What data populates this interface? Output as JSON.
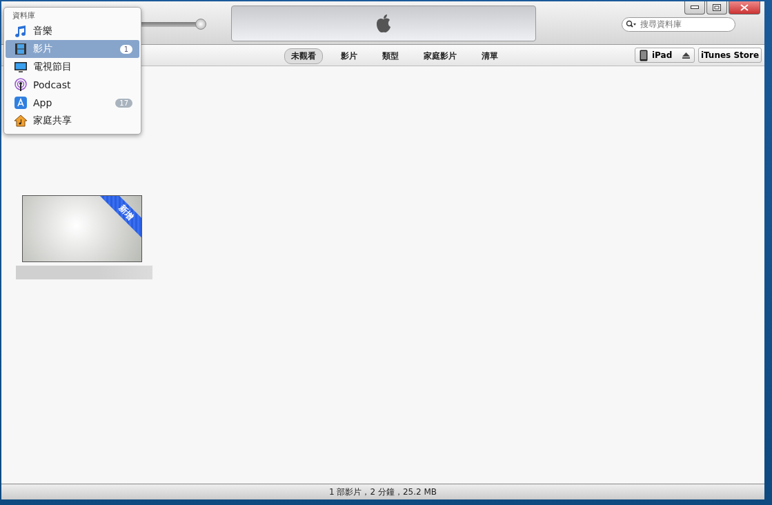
{
  "toolbar": {
    "volume": {
      "level": 0.96
    },
    "search": {
      "placeholder": "搜尋資料庫"
    }
  },
  "library_menu": {
    "title": "資料庫",
    "items": [
      {
        "label": "音樂",
        "kind": "music",
        "selected": false
      },
      {
        "label": "影片",
        "kind": "film",
        "selected": true,
        "badge": "1"
      },
      {
        "label": "電視節目",
        "kind": "tv",
        "selected": false
      },
      {
        "label": "Podcast",
        "kind": "podcast",
        "selected": false
      },
      {
        "label": "App",
        "kind": "app",
        "selected": false,
        "badge": "17"
      },
      {
        "label": "家庭共享",
        "kind": "home",
        "selected": false
      }
    ]
  },
  "view_tabs": [
    {
      "label": "未觀看",
      "selected": true
    },
    {
      "label": "影片",
      "selected": false
    },
    {
      "label": "類型",
      "selected": false
    },
    {
      "label": "家庭影片",
      "selected": false
    },
    {
      "label": "清單",
      "selected": false
    }
  ],
  "device": {
    "name": "iPad"
  },
  "store_button": "iTunes Store",
  "movies": [
    {
      "badge": "新增"
    }
  ],
  "status_bar": "1 部影片，2 分鐘，25.2 MB"
}
